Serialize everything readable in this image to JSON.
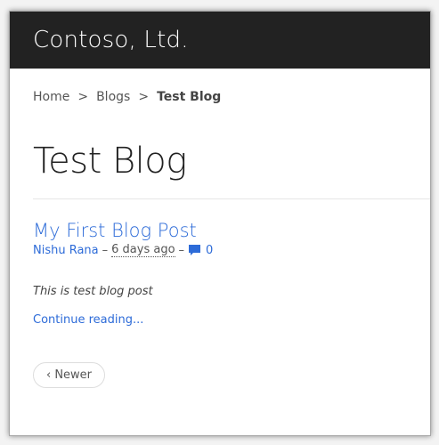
{
  "header": {
    "brand": "Contoso, Ltd."
  },
  "breadcrumb": {
    "items": [
      "Home",
      "Blogs",
      "Test Blog"
    ],
    "separator": ">"
  },
  "page": {
    "title": "Test Blog"
  },
  "post": {
    "title": "My First Blog Post",
    "author": "Nishu Rana",
    "separator": "–",
    "time": "6 days ago",
    "comment_count": "0",
    "comment_icon": "comment-icon",
    "excerpt": "This is test blog post",
    "continue_label": "Continue reading..."
  },
  "pager": {
    "newer_label": "‹ Newer"
  },
  "colors": {
    "header_bg": "#222222",
    "link": "#2d6bd8",
    "text": "#555555"
  }
}
